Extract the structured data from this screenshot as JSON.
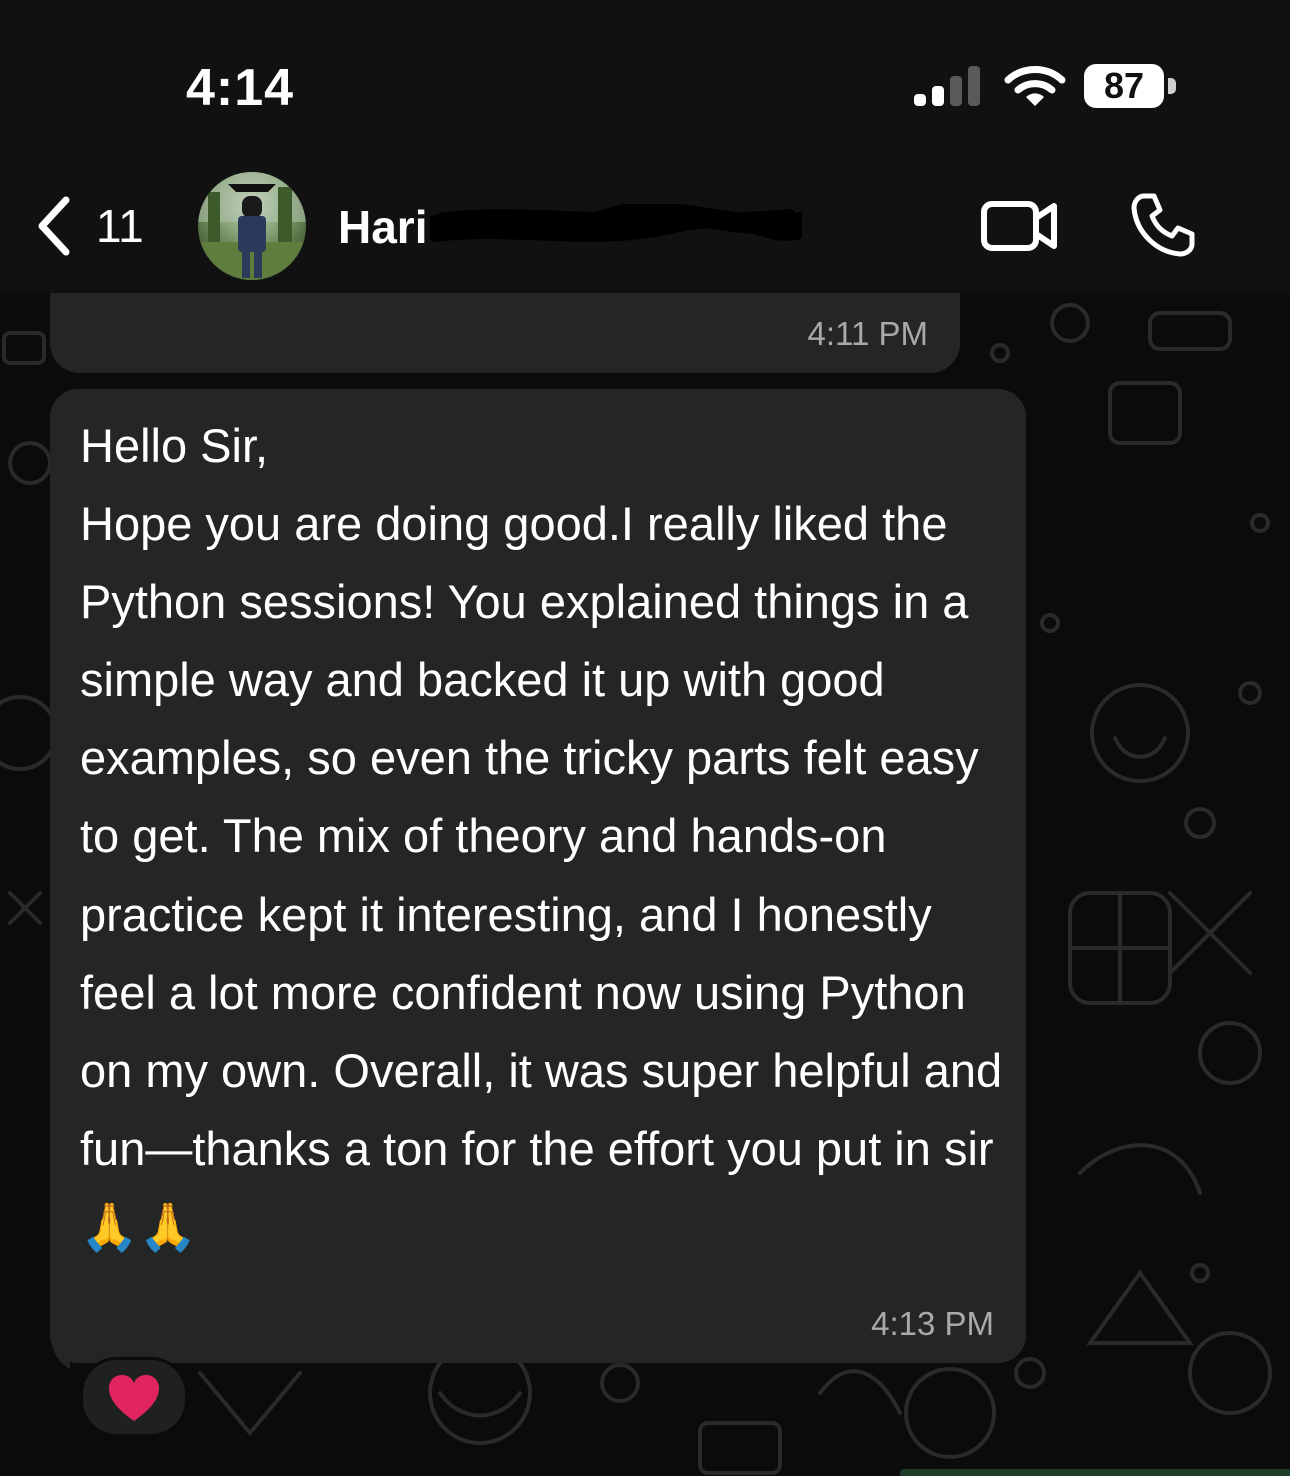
{
  "status_bar": {
    "time": "4:14",
    "battery": "87",
    "signal_icon": "signal-bars-icon",
    "wifi_icon": "wifi-icon"
  },
  "header": {
    "back_count": "11",
    "contact_name": "Hari",
    "back_icon": "chevron-left-icon",
    "video_icon": "video-camera-icon",
    "call_icon": "phone-icon"
  },
  "messages": [
    {
      "time": "4:11 PM"
    },
    {
      "text": "Hello Sir,\nHope you are doing good.I really liked the Python sessions! You explained things in a simple way and backed it up with good examples, so even the tricky parts felt easy to get. The mix of theory and hands-on practice kept it interesting, and I honestly feel a lot more confident now using Python on my own. Overall, it was super helpful and fun—thanks a ton for the effort you put in sir🙏🙏",
      "time": "4:13 PM",
      "reaction": "❤️"
    }
  ],
  "colors": {
    "background": "#0b0b0b",
    "bar": "#111111",
    "bubble": "#242626",
    "timestamp": "#a9a9a9",
    "heart": "#e0245e"
  }
}
